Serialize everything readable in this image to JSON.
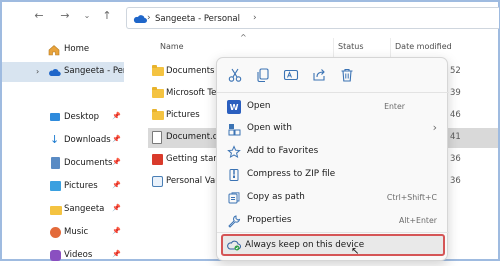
{
  "address": {
    "path": [
      "Sangeeta - Personal"
    ]
  },
  "sidebar": {
    "items": [
      {
        "label": "Home",
        "pinned": false
      },
      {
        "label": "Sangeeta - Perso",
        "pinned": false
      },
      {
        "label": "Desktop",
        "pinned": true
      },
      {
        "label": "Downloads",
        "pinned": true
      },
      {
        "label": "Documents",
        "pinned": true
      },
      {
        "label": "Pictures",
        "pinned": true
      },
      {
        "label": "Sangeeta",
        "pinned": true
      },
      {
        "label": "Music",
        "pinned": true
      },
      {
        "label": "Videos",
        "pinned": true
      }
    ]
  },
  "list": {
    "columns": [
      "Name",
      "Status",
      "Date modified"
    ],
    "rows": [
      {
        "name": "Documents",
        "date": "52"
      },
      {
        "name": "Microsoft Tea",
        "date": "39"
      },
      {
        "name": "Pictures",
        "date": "46"
      },
      {
        "name": "Document.do",
        "date": "41"
      },
      {
        "name": "Getting starte",
        "date": "36"
      },
      {
        "name": "Personal Vaul",
        "date": "36"
      }
    ]
  },
  "context_menu": {
    "quick_actions": [
      "cut-icon",
      "copy-icon",
      "rename-icon",
      "share-icon",
      "delete-icon"
    ],
    "items": [
      {
        "label": "Open",
        "shortcut": "Enter"
      },
      {
        "label": "Open with",
        "submenu_arrow": "›"
      },
      {
        "label": "Add to Favorites"
      },
      {
        "label": "Compress to ZIP file"
      },
      {
        "label": "Copy as path",
        "shortcut": "Ctrl+Shift+C"
      },
      {
        "label": "Properties",
        "shortcut": "Alt+Enter"
      },
      {
        "label": "Always keep on this device"
      }
    ]
  },
  "colors": {
    "accent": "#3a6fa8",
    "highlight_border": "#d55556",
    "selection": "#d9d9d9",
    "folder": "#f4c341"
  }
}
